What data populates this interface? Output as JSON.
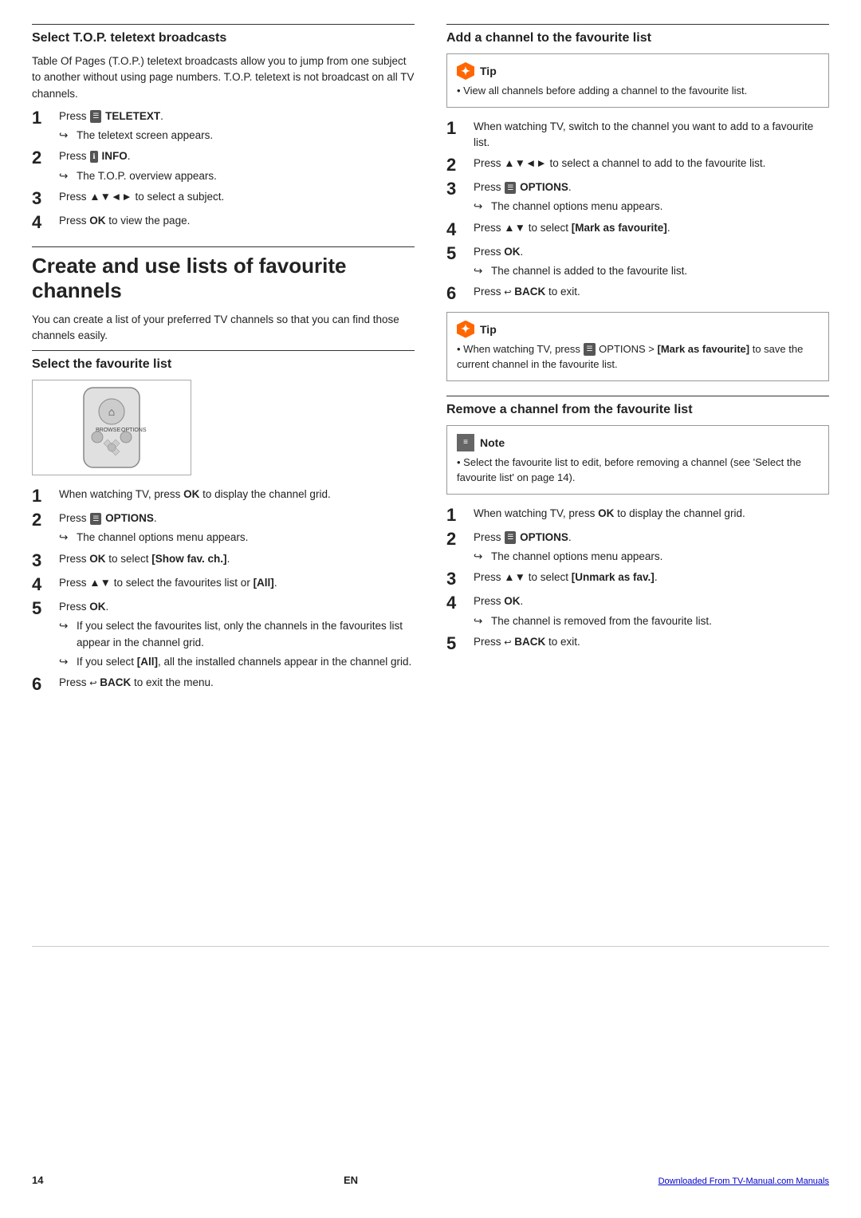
{
  "left": {
    "section1": {
      "title": "Select T.O.P. teletext broadcasts",
      "body": "Table Of Pages (T.O.P.) teletext broadcasts allow you to jump from one subject to another without using page numbers. T.O.P. teletext is not broadcast on all TV channels.",
      "steps": [
        {
          "num": "1",
          "text": "Press ",
          "bold_part": "TELETEXT",
          "icon": "teletext",
          "sub": "The teletext screen appears."
        },
        {
          "num": "2",
          "text": "Press ",
          "bold_part": "INFO",
          "icon": "info",
          "sub": "The T.O.P. overview appears."
        },
        {
          "num": "3",
          "text": "Press ▲▼◄► to select a subject.",
          "bold_part": "",
          "sub": ""
        },
        {
          "num": "4",
          "text": "Press ",
          "bold_part": "OK",
          "suffix": " to view the page.",
          "sub": ""
        }
      ]
    },
    "section2": {
      "title": "Create and use lists of favourite channels",
      "body": "You can create a list of your preferred TV channels so that you can find those channels easily.",
      "sub_section": {
        "title": "Select the favourite list",
        "steps": [
          {
            "num": "1",
            "text": "When watching TV, press ",
            "bold_part": "OK",
            "suffix": " to display the channel grid.",
            "sub": ""
          },
          {
            "num": "2",
            "text": "Press ",
            "icon": "options",
            "bold_part": "OPTIONS",
            "suffix": ".",
            "sub": "The channel options menu appears."
          },
          {
            "num": "3",
            "text": "Press ",
            "bold_part": "OK",
            "suffix": " to select [Show fav. ch.].",
            "sub": ""
          },
          {
            "num": "4",
            "text": "Press ▲▼ to select the favourites list or [All].",
            "sub": ""
          },
          {
            "num": "5",
            "text": "Press ",
            "bold_part": "OK",
            "suffix": ".",
            "sub_bullets": [
              "If you select the favourites list, only the channels in the favourites list appear in the channel grid.",
              "If you select [All], all the installed channels appear in the channel grid."
            ]
          },
          {
            "num": "6",
            "text": "Press ",
            "icon": "back",
            "bold_part": "BACK",
            "suffix": " to exit the menu.",
            "sub": ""
          }
        ]
      }
    }
  },
  "right": {
    "section1": {
      "title": "Add a channel to the favourite list",
      "tip1": {
        "label": "Tip",
        "text": "View all channels before adding a channel to the favourite list."
      },
      "steps": [
        {
          "num": "1",
          "text": "When watching TV, switch to the channel you want to add to a favourite list.",
          "sub": ""
        },
        {
          "num": "2",
          "text": "Press ▲▼◄► to select a channel to add to the favourite list.",
          "sub": ""
        },
        {
          "num": "3",
          "text": "Press ",
          "icon": "options",
          "bold_part": "OPTIONS",
          "suffix": ".",
          "sub": "The channel options menu appears."
        },
        {
          "num": "4",
          "text": "Press ▲▼ to select [Mark as favourite].",
          "sub": ""
        },
        {
          "num": "5",
          "text": "Press ",
          "bold_part": "OK",
          "suffix": ".",
          "sub": "The channel is added to the favourite list."
        },
        {
          "num": "6",
          "text": "Press ",
          "icon": "back",
          "bold_part": "BACK",
          "suffix": " to exit.",
          "sub": ""
        }
      ],
      "tip2": {
        "label": "Tip",
        "text": "When watching TV, press  OPTIONS > [Mark as favourite] to save the current channel in the favourite list."
      }
    },
    "section2": {
      "title": "Remove a channel from the favourite list",
      "note": {
        "label": "Note",
        "text": "Select the favourite list to edit, before removing a channel (see 'Select the favourite list' on page 14)."
      },
      "steps": [
        {
          "num": "1",
          "text": "When watching TV, press ",
          "bold_part": "OK",
          "suffix": " to display the channel grid.",
          "sub": ""
        },
        {
          "num": "2",
          "text": "Press ",
          "icon": "options",
          "bold_part": "OPTIONS",
          "suffix": ".",
          "sub": "The channel options menu appears."
        },
        {
          "num": "3",
          "text": "Press ▲▼ to select [Unmark as fav.].",
          "sub": ""
        },
        {
          "num": "4",
          "text": "Press ",
          "bold_part": "OK",
          "suffix": ".",
          "sub": "The channel is removed from the favourite list."
        },
        {
          "num": "5",
          "text": "Press ",
          "icon": "back",
          "bold_part": "BACK",
          "suffix": " to exit.",
          "sub": ""
        }
      ]
    }
  },
  "footer": {
    "page": "14",
    "lang": "EN",
    "link": "Downloaded From TV-Manual.com Manuals"
  }
}
